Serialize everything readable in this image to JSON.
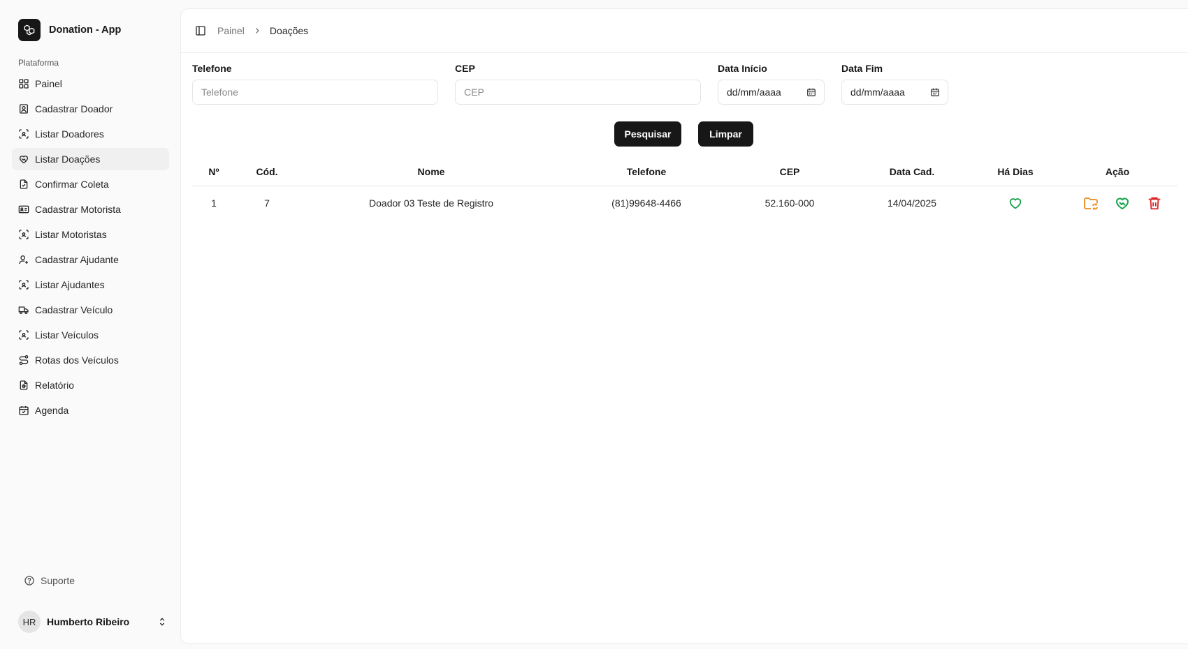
{
  "app": {
    "name": "Donation - App"
  },
  "sidebar": {
    "section_label": "Plataforma",
    "items": [
      {
        "label": "Painel",
        "icon": "grid-icon"
      },
      {
        "label": "Cadastrar Doador",
        "icon": "user-square-icon"
      },
      {
        "label": "Listar Doadores",
        "icon": "scan-user-icon"
      },
      {
        "label": "Listar Doações",
        "icon": "handshake-heart-icon",
        "active": true
      },
      {
        "label": "Confirmar Coleta",
        "icon": "file-check-icon"
      },
      {
        "label": "Cadastrar Motorista",
        "icon": "id-card-icon"
      },
      {
        "label": "Listar Motoristas",
        "icon": "scan-user-icon"
      },
      {
        "label": "Cadastrar Ajudante",
        "icon": "user-plus-icon"
      },
      {
        "label": "Listar Ajudantes",
        "icon": "scan-user-icon"
      },
      {
        "label": "Cadastrar Veículo",
        "icon": "truck-icon"
      },
      {
        "label": "Listar Veículos",
        "icon": "scan-user-icon"
      },
      {
        "label": "Rotas dos Veículos",
        "icon": "route-icon"
      },
      {
        "label": "Relatório",
        "icon": "file-chart-icon"
      },
      {
        "label": "Agenda",
        "icon": "calendar-check-icon"
      }
    ],
    "support_label": "Suporte",
    "user": {
      "initials": "HR",
      "name": "Humberto Ribeiro"
    }
  },
  "breadcrumb": {
    "root": "Painel",
    "current": "Doações"
  },
  "filters": {
    "telefone": {
      "label": "Telefone",
      "placeholder": "Telefone"
    },
    "cep": {
      "label": "CEP",
      "placeholder": "CEP"
    },
    "data_inicio": {
      "label": "Data Início",
      "value": "dd/mm/aaaa"
    },
    "data_fim": {
      "label": "Data Fim",
      "value": "dd/mm/aaaa"
    },
    "search_label": "Pesquisar",
    "clear_label": "Limpar"
  },
  "table": {
    "headers": [
      "Nº",
      "Cód.",
      "Nome",
      "Telefone",
      "CEP",
      "Data Cad.",
      "Há Dias",
      "Ação"
    ],
    "rows": [
      {
        "n": "1",
        "cod": "7",
        "nome": "Doador 03 Teste de Registro",
        "telefone": "(81)99648-4466",
        "cep": "52.160-000",
        "data_cad": "14/04/2025"
      }
    ]
  },
  "colors": {
    "accent_dark": "#171717",
    "heart_green": "#16a34a",
    "folder_orange": "#ea8a1c",
    "delete_red": "#dc2626"
  }
}
